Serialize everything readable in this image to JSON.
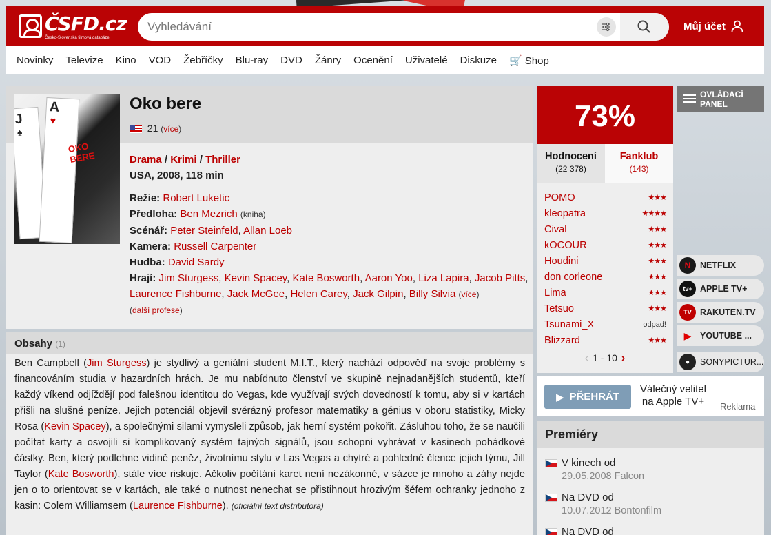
{
  "site": {
    "logo_text": "ČSFD.cz",
    "logo_sub": "Česko-Slovenská filmová databáze"
  },
  "header": {
    "search_placeholder": "Vyhledávání",
    "account_label": "Můj účet"
  },
  "nav": [
    "Novinky",
    "Televize",
    "Kino",
    "VOD",
    "Žebříčky",
    "Blu-ray",
    "DVD",
    "Žánry",
    "Ocenění",
    "Uživatelé",
    "Diskuze",
    "Shop"
  ],
  "film": {
    "title": "Oko bere",
    "names_count": "21",
    "names_more": "více",
    "genres": [
      "Drama",
      "Krimi",
      "Thriller"
    ],
    "origin": "USA, 2008, 118 min",
    "crew": {
      "director_label": "Režie:",
      "director": "Robert Luketic",
      "source_label": "Předloha:",
      "source": "Ben Mezrich",
      "source_note": "(kniha)",
      "writers_label": "Scénář:",
      "writer1": "Peter Steinfeld",
      "writer2": "Allan Loeb",
      "camera_label": "Kamera:",
      "camera": "Russell Carpenter",
      "music_label": "Hudba:",
      "music": "David Sardy",
      "cast_label": "Hrají:",
      "cast": [
        "Jim Sturgess",
        "Kevin Spacey",
        "Kate Bosworth",
        "Aaron Yoo",
        "Liza Lapira",
        "Jacob Pitts",
        "Laurence Fishburne",
        "Jack McGee",
        "Helen Carey",
        "Jack Gilpin",
        "Billy Silvia"
      ],
      "cast_more": "více",
      "more_professions": "další profese"
    }
  },
  "plot": {
    "heading": "Obsahy",
    "count": "(1)",
    "p1": "Ben Campbell (",
    "a1": "Jim Sturgess",
    "p2": ") je stydlivý a geniální student M.I.T., který nachází odpověď na svoje problémy s financováním studia v hazardních hrách. Je mu nabídnuto členství ve skupině nejnadanějších studentů, kteří každý víkend odjíždějí pod falešnou identitou do Vegas, kde využívají svých dovedností k tomu, aby si v kartách přišli na slušné peníze. Jejich potenciál objevil svérázný profesor matematiky a génius v oboru statistiky, Micky Rosa (",
    "a2": "Kevin Spacey",
    "p3": "), a společnými silami vymysleli způsob, jak herní systém pokořit. Zásluhou toho, že se naučili počítat karty a osvojili si komplikovaný systém tajných signálů, jsou schopni vyhrávat v kasinech pohádkové částky. Ben, který podlehne vidině peněz, životnímu stylu v Las Vegas a chytré a pohledné člence jejich týmu, Jill Taylor (",
    "a3": "Kate Bosworth",
    "p4": "), stále více riskuje. Ačkoliv počítání karet není nezákonné, v sázce je mnoho a záhy nejde jen o to orientovat se v kartách, ale také o nutnost nenechat se přistihnout hrozivým šéfem ochranky jednoho z kasin: Colem Williamsem (",
    "a4": "Laurence Fishburne",
    "p5": "). ",
    "source": "(oficiální text distributora)"
  },
  "rating": {
    "score": "73%",
    "tab_ratings": "Hodnocení",
    "tab_ratings_count": "(22 378)",
    "tab_fanclub": "Fanklub",
    "tab_fanclub_count": "(143)",
    "users": [
      {
        "name": "POMO",
        "stars": "★★★"
      },
      {
        "name": "kleopatra",
        "stars": "★★★★"
      },
      {
        "name": "Cival",
        "stars": "★★★"
      },
      {
        "name": "kOCOUR",
        "stars": "★★★"
      },
      {
        "name": "Houdini",
        "stars": "★★★"
      },
      {
        "name": "don corleone",
        "stars": "★★★"
      },
      {
        "name": "Lima",
        "stars": "★★★"
      },
      {
        "name": "Tetsuo",
        "stars": "★★★"
      },
      {
        "name": "Tsunami_X",
        "stars": "odpad!"
      },
      {
        "name": "Blizzard",
        "stars": "★★★"
      }
    ],
    "pager": "1 - 10"
  },
  "control_panel": "OVLÁDACÍ PANEL",
  "streaming": [
    {
      "name": "NETFLIX",
      "icon": "N",
      "color": "#1a1a1a"
    },
    {
      "name": "APPLE TV+",
      "icon": "tv+",
      "color": "#111111"
    },
    {
      "name": "RAKUTEN.TV",
      "icon": "TV",
      "color": "#bf0000"
    },
    {
      "name": "YOUTUBE ...",
      "icon": "▶",
      "color": "#e00000"
    },
    {
      "name": "SONYPICTUR...",
      "icon": "●",
      "color": "#222222"
    }
  ],
  "ad": {
    "play_label": "PŘEHRÁT",
    "text": "Válečný velitel na Apple TV+",
    "label": "Reklama"
  },
  "premieres": {
    "heading": "Premiéry",
    "items": [
      {
        "type": "V kinech od",
        "date": "29.05.2008 Falcon"
      },
      {
        "type": "Na DVD od",
        "date": "10.07.2012 Bontonfilm"
      },
      {
        "type": "Na DVD od",
        "date": ""
      }
    ]
  }
}
